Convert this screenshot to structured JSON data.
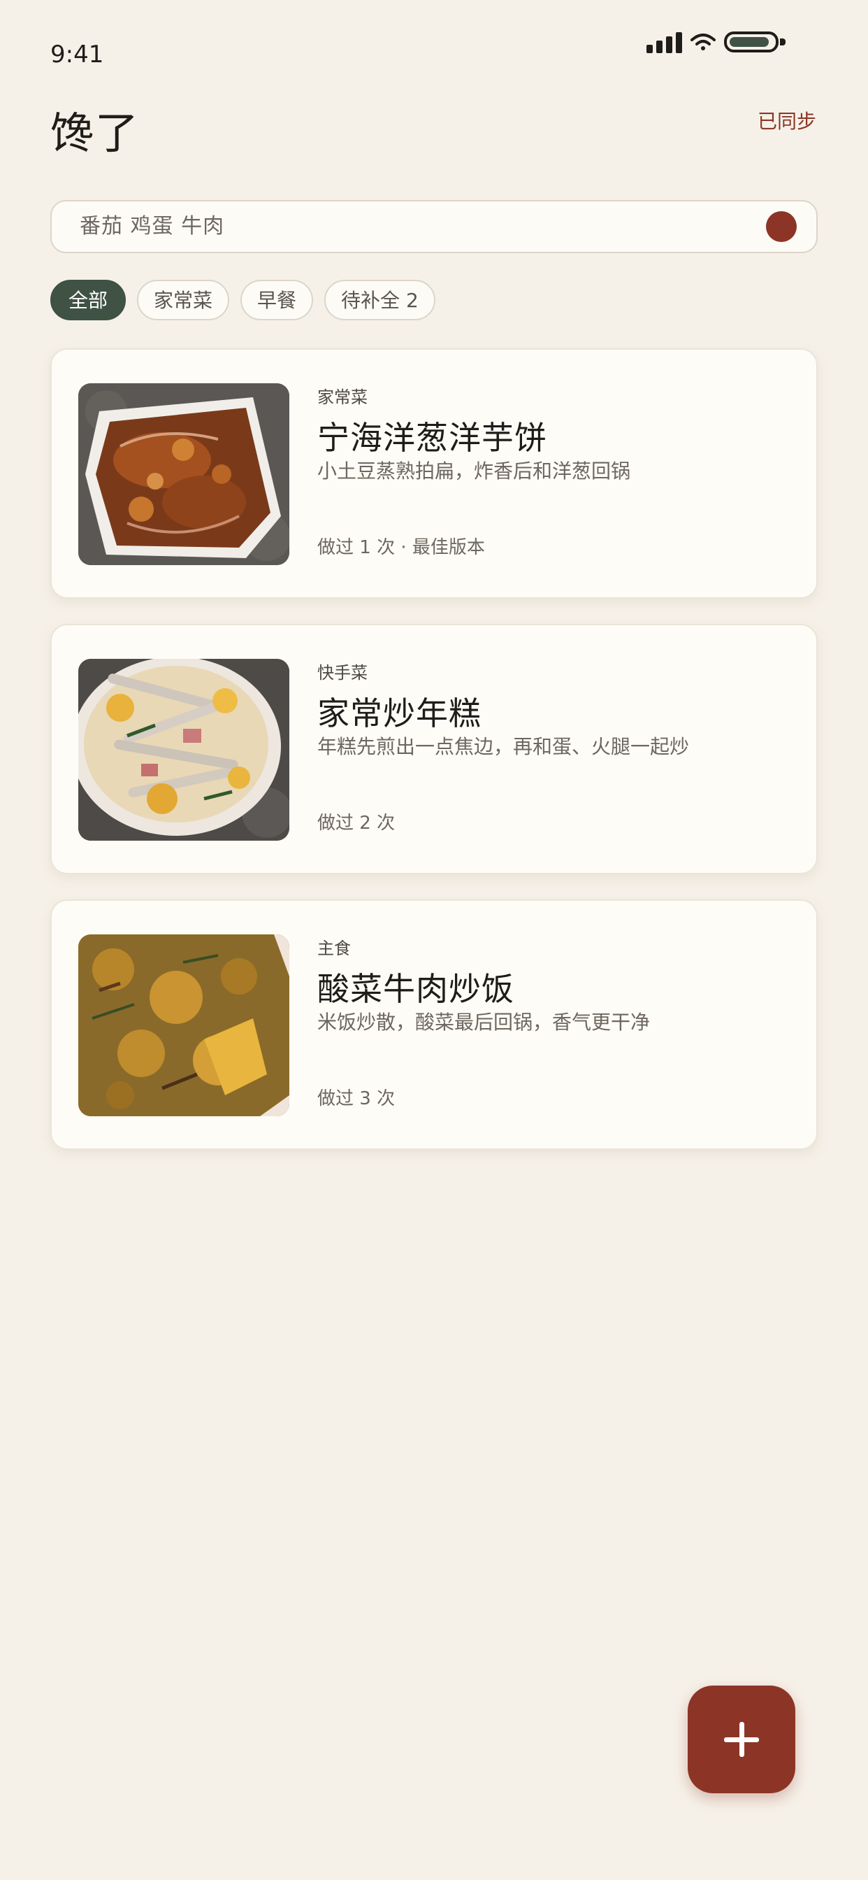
{
  "status_bar": {
    "time": "9:41",
    "icons": [
      "signal-icon",
      "wifi-icon",
      "battery-icon"
    ]
  },
  "header": {
    "title": "馋了",
    "sync_status": "已同步"
  },
  "search": {
    "value": "番茄 鸡蛋 牛肉",
    "icon": "voice-dot-icon"
  },
  "filters": [
    {
      "label": "全部",
      "active": true
    },
    {
      "label": "家常菜",
      "active": false
    },
    {
      "label": "早餐",
      "active": false
    },
    {
      "label": "待补全 2",
      "active": false
    }
  ],
  "recipes": [
    {
      "category": "家常菜",
      "title": "宁海洋葱洋芋饼",
      "description": "小土豆蒸熟拍扁，炸香后和洋葱回锅",
      "meta": "做过 1 次 · 最佳版本"
    },
    {
      "category": "快手菜",
      "title": "家常炒年糕",
      "description": "年糕先煎出一点焦边，再和蛋、火腿一起炒",
      "meta": "做过 2 次"
    },
    {
      "category": "主食",
      "title": "酸菜牛肉炒饭",
      "description": "米饭炒散，酸菜最后回锅，香气更干净",
      "meta": "做过 3 次"
    }
  ],
  "fab": {
    "icon": "plus-icon"
  },
  "colors": {
    "background": "#f6f1e8",
    "accent": "#8c3527",
    "primary_green": "#3f5243",
    "card": "#fefcf6"
  }
}
